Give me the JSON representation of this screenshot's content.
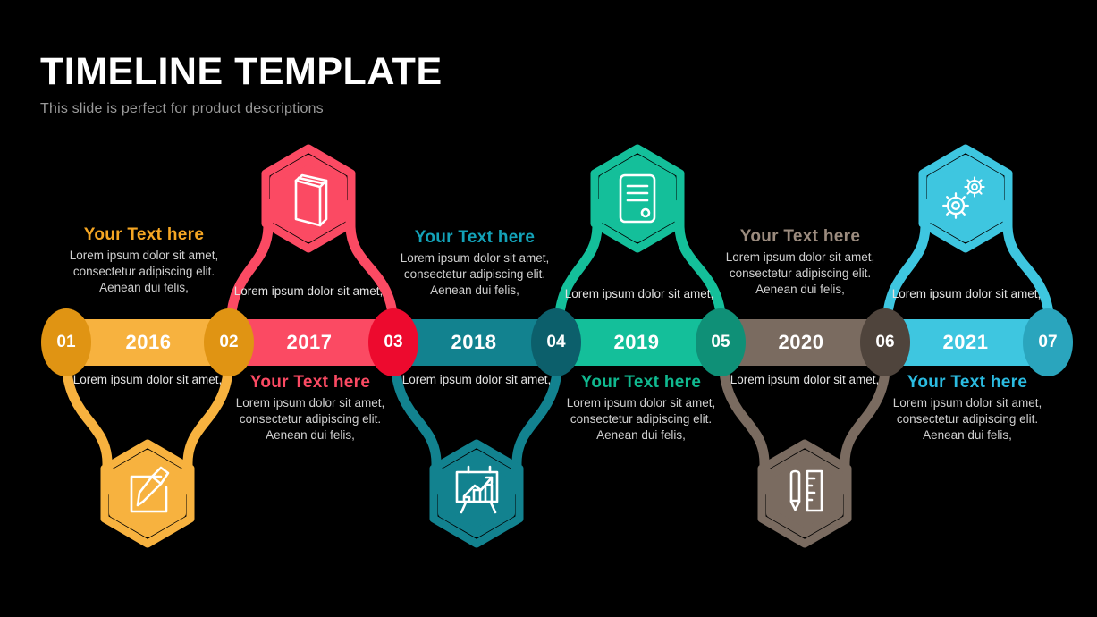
{
  "header": {
    "title": "TIMELINE TEMPLATE",
    "subtitle": "This slide is perfect for product descriptions"
  },
  "colors": {
    "amber_bar": "#f7b23f",
    "amber_node": "#e09413",
    "pink_bar": "#fb4a63",
    "pink_node": "#ed0a2e",
    "teal_bar": "#12828f",
    "teal_node": "#0c5f6b",
    "green_bar": "#14bf9a",
    "green_node": "#0f9077",
    "gray_bar": "#7a6b60",
    "gray_node": "#4f443c",
    "cyan_bar": "#3ec6e0",
    "cyan_node": "#2aa5bd",
    "body_text": "#cfcfcf",
    "title_text": "#ffffff",
    "subtitle_text": "#9a9a9a",
    "background": "#000000"
  },
  "common": {
    "heading": "Your  Text here",
    "body": "Lorem ipsum dolor sit amet,  consectetur adipiscing  elit. Aenean  dui felis,",
    "short": "Lorem ipsum dolor sit amet,"
  },
  "segments": [
    {
      "node_number": "01",
      "year": "2016",
      "bar_color": "#f7b23f",
      "node_color": "#e09413",
      "heading_color": "#f5a623",
      "heading": "Your  Text here",
      "body": "Lorem ipsum dolor sit amet,  consectetur adipiscing  elit. Aenean  dui felis,",
      "short": "Lorem ipsum dolor sit amet,",
      "icon": "edit-pencil-icon",
      "icon_position": "bottom",
      "text_position": "above"
    },
    {
      "node_number": "02",
      "year": "2017",
      "bar_color": "#fb4a63",
      "node_color": "#e09413",
      "heading_color": "#fb4a63",
      "heading": "Your  Text here",
      "body": "Lorem ipsum dolor sit amet,  consectetur adipiscing  elit. Aenean  dui felis,",
      "short": "Lorem ipsum dolor sit amet,",
      "icon": "book-icon",
      "icon_position": "top",
      "text_position": "below"
    },
    {
      "node_number": "03",
      "year": "2018",
      "bar_color": "#12828f",
      "node_color": "#ed0a2e",
      "heading_color": "#13a2b8",
      "heading": "Your  Text here",
      "body": "Lorem ipsum dolor sit amet,  consectetur adipiscing  elit. Aenean  dui felis,",
      "short": "Lorem ipsum dolor sit amet,",
      "icon": "presentation-chart-icon",
      "icon_position": "bottom",
      "text_position": "above"
    },
    {
      "node_number": "04",
      "year": "2019",
      "bar_color": "#14bf9a",
      "node_color": "#0c5f6b",
      "heading_color": "#10b88f",
      "heading": "Your  Text here",
      "body": "Lorem ipsum dolor sit amet,  consectetur adipiscing  elit. Aenean  dui felis,",
      "short": "Lorem ipsum dolor sit amet,",
      "icon": "document-server-icon",
      "icon_position": "top",
      "text_position": "below"
    },
    {
      "node_number": "05",
      "year": "2020",
      "bar_color": "#7a6b60",
      "node_color": "#0f9077",
      "heading_color": "#9b8b7e",
      "heading": "Your  Text here",
      "body": "Lorem ipsum dolor sit amet,  consectetur adipiscing  elit. Aenean  dui felis,",
      "short": "Lorem ipsum dolor sit amet,",
      "icon": "pencil-ruler-icon",
      "icon_position": "bottom",
      "text_position": "above"
    },
    {
      "node_number": "06",
      "year": "2021",
      "bar_color": "#3ec6e0",
      "node_color": "#4f443c",
      "heading_color": "#2bbbe0",
      "heading": "Your  Text here",
      "body": "Lorem ipsum dolor sit amet,  consectetur adipiscing  elit. Aenean  dui felis,",
      "short": "Lorem ipsum dolor sit amet,",
      "icon": "gears-icon",
      "icon_position": "top",
      "text_position": "below"
    },
    {
      "node_number": "07",
      "year": "",
      "bar_color": "",
      "node_color": "#2aa5bd",
      "heading_color": "",
      "heading": "",
      "body": "",
      "short": "",
      "icon": "",
      "icon_position": "",
      "text_position": ""
    }
  ]
}
